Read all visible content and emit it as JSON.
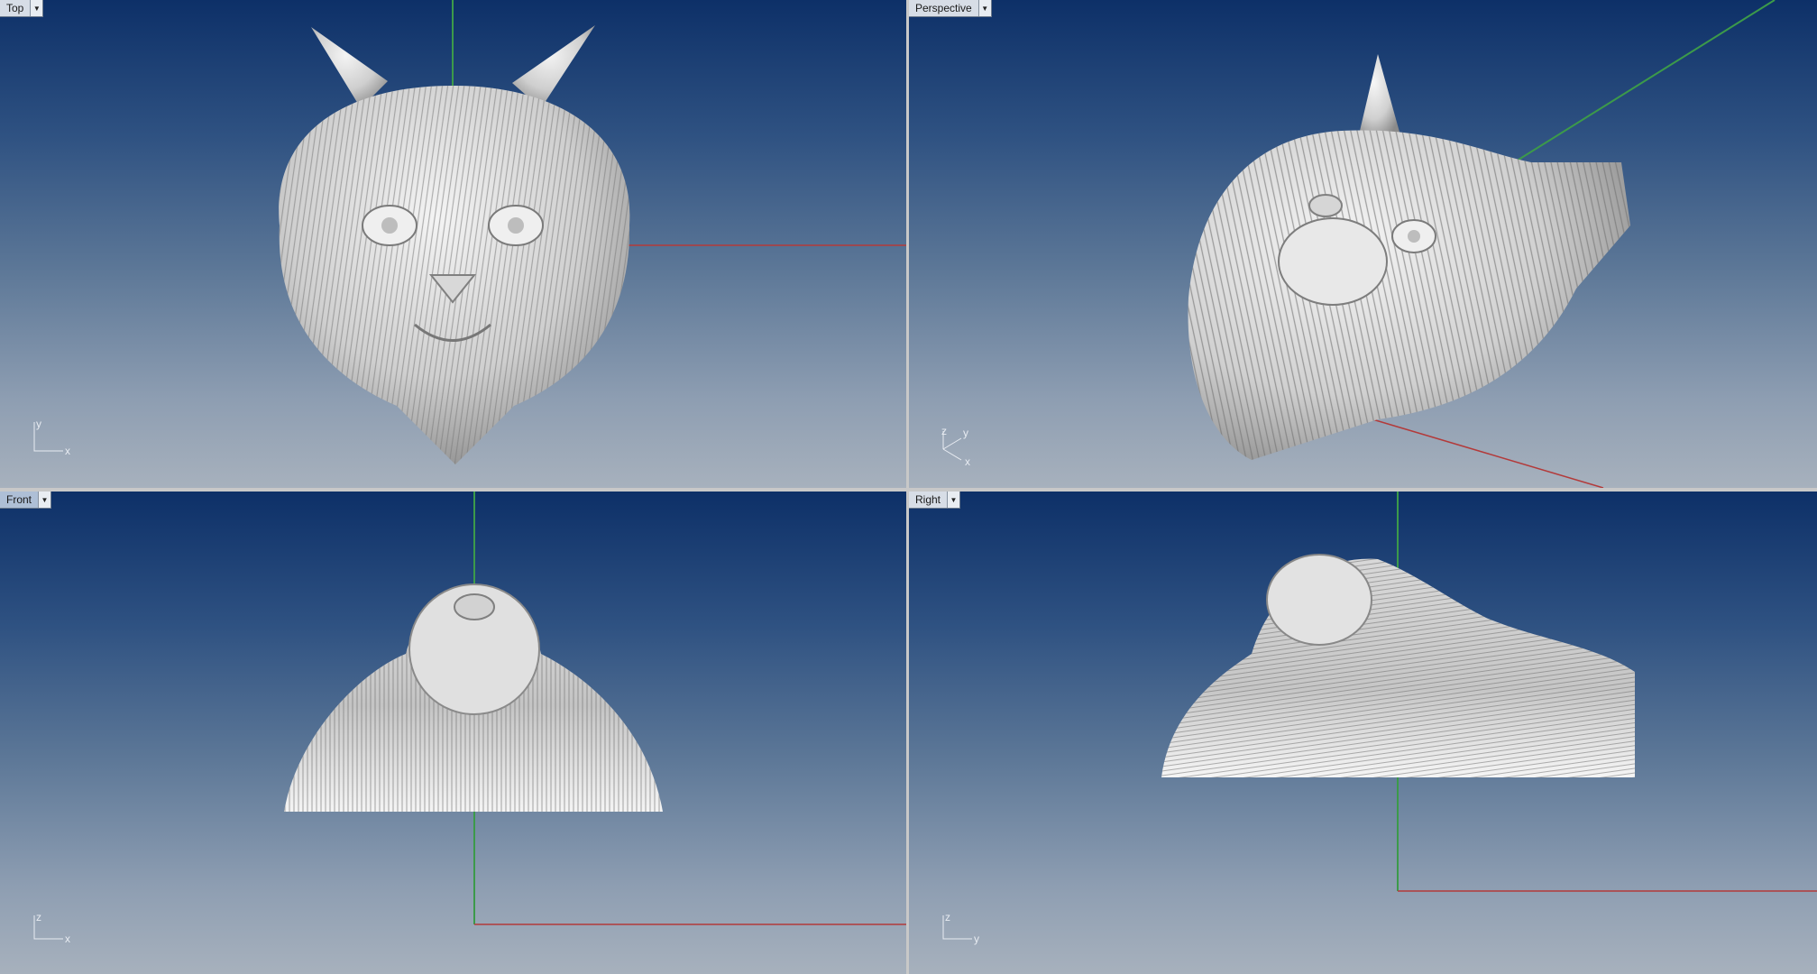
{
  "viewports": {
    "top": {
      "title": "Top"
    },
    "persp": {
      "title": "Perspective"
    },
    "front": {
      "title": "Front"
    },
    "right": {
      "title": "Right"
    }
  },
  "axis_icons": {
    "top": {
      "a": "y",
      "b": "x"
    },
    "persp": {
      "a": "z",
      "b": "y",
      "c": "x"
    },
    "front": {
      "a": "z",
      "b": "x"
    },
    "right": {
      "a": "z",
      "b": "y"
    }
  },
  "active_viewport": "front",
  "colors": {
    "x_axis": "#b33a3a",
    "y_axis": "#3c9a4a",
    "model": "#e3e3e3"
  },
  "icons": {
    "viewport_menu": "chevron-down-icon",
    "axis_widget": "axis-triad-icon"
  }
}
